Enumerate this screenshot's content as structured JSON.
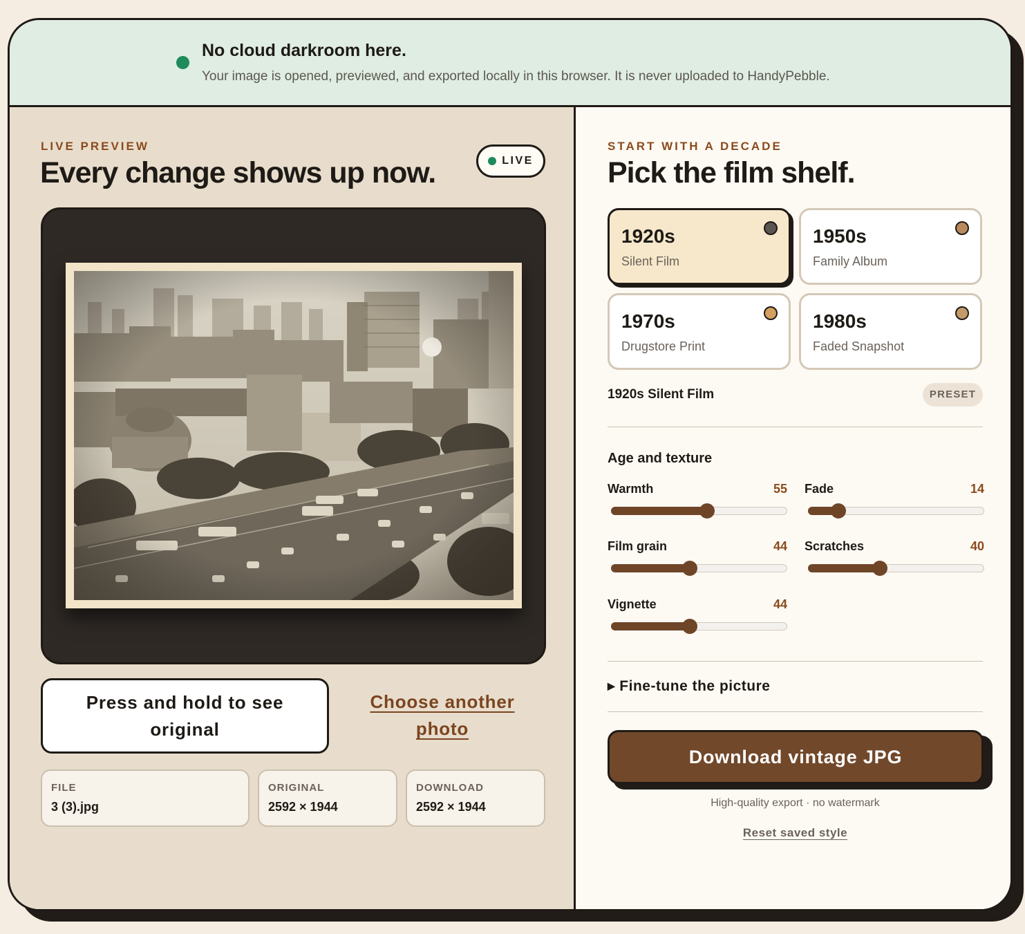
{
  "banner": {
    "title": "No cloud darkroom here.",
    "text": "Your image is opened, previewed, and exported locally in this browser. It is never uploaded to HandyPebble."
  },
  "preview": {
    "eyebrow": "LIVE PREVIEW",
    "headline": "Every change shows up now.",
    "live_badge": "LIVE",
    "hold_button": "Press and hold to see original",
    "choose_link": "Choose another photo",
    "file": {
      "label": "FILE",
      "value": "3 (3).jpg"
    },
    "original": {
      "label": "ORIGINAL",
      "value": "2592 × 1944"
    },
    "download": {
      "label": "DOWNLOAD",
      "value": "2592 × 1944"
    }
  },
  "shelf": {
    "eyebrow": "START WITH A DECADE",
    "headline": "Pick the film shelf.",
    "decades": [
      {
        "year": "1920s",
        "name": "Silent Film",
        "swatch": "#5a5550",
        "active": true
      },
      {
        "year": "1950s",
        "name": "Family Album",
        "swatch": "#b98a5c",
        "active": false
      },
      {
        "year": "1970s",
        "name": "Drugstore Print",
        "swatch": "#d4a060",
        "active": false
      },
      {
        "year": "1980s",
        "name": "Faded Snapshot",
        "swatch": "#c49a6a",
        "active": false
      }
    ],
    "preset_name": "1920s Silent Film",
    "preset_badge": "PRESET"
  },
  "controls": {
    "section_title": "Age and texture",
    "sliders": [
      {
        "label": "Warmth",
        "value": "55",
        "level": 0.55
      },
      {
        "label": "Fade",
        "value": "14",
        "level": 0.14
      },
      {
        "label": "Film grain",
        "value": "44",
        "level": 0.44
      },
      {
        "label": "Scratches",
        "value": "40",
        "level": 0.4
      },
      {
        "label": "Vignette",
        "value": "44",
        "level": 0.44
      }
    ],
    "fine_tune": "Fine-tune the picture",
    "download_button": "Download vintage JPG",
    "export_note": "High-quality export · no watermark",
    "reset_link": "Reset saved style"
  },
  "colors": {
    "accent": "#71482a",
    "live_green": "#1f8a5a",
    "eyebrow": "#8a4a1c"
  }
}
